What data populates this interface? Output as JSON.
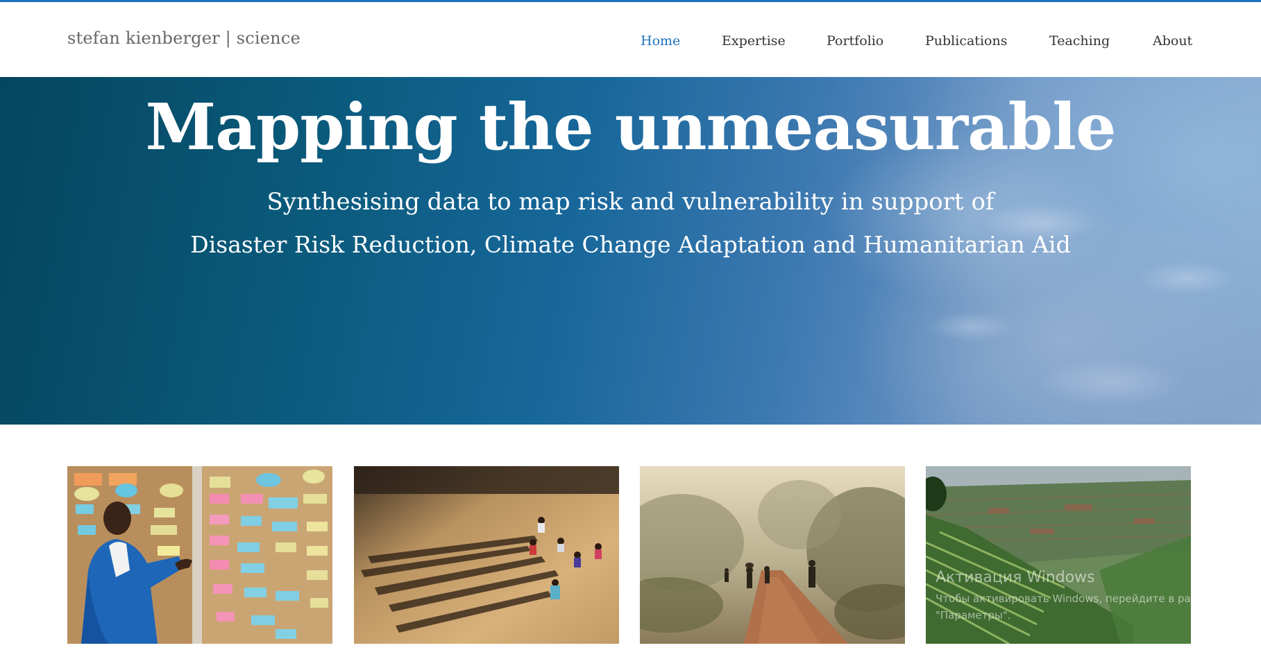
{
  "site": {
    "logo": "stefan kienberger | science"
  },
  "nav": {
    "items": [
      {
        "label": "Home",
        "active": true
      },
      {
        "label": "Expertise",
        "active": false
      },
      {
        "label": "Portfolio",
        "active": false
      },
      {
        "label": "Publications",
        "active": false
      },
      {
        "label": "Teaching",
        "active": false
      },
      {
        "label": "About",
        "active": false
      }
    ]
  },
  "hero": {
    "title": "Mapping the unmeasurable",
    "subtitle_line1": "Synthesising data to map risk and vulnerability in support of",
    "subtitle_line2": "Disaster Risk Reduction, Climate Change Adaptation and Humanitarian Aid"
  },
  "gallery": {
    "images": [
      {
        "name": "workshop-photo"
      },
      {
        "name": "aerial-people-photo"
      },
      {
        "name": "misty-road-photo"
      },
      {
        "name": "terraced-hills-photo"
      }
    ]
  },
  "windows_watermark": {
    "title": "Активация Windows",
    "text_line1": "Чтобы активировать Windows, перейдите в раздел",
    "text_line2": "\"Параметры\"."
  },
  "colors": {
    "accent": "#1e73be",
    "nav_text": "#333333",
    "logo_text": "#666666"
  }
}
